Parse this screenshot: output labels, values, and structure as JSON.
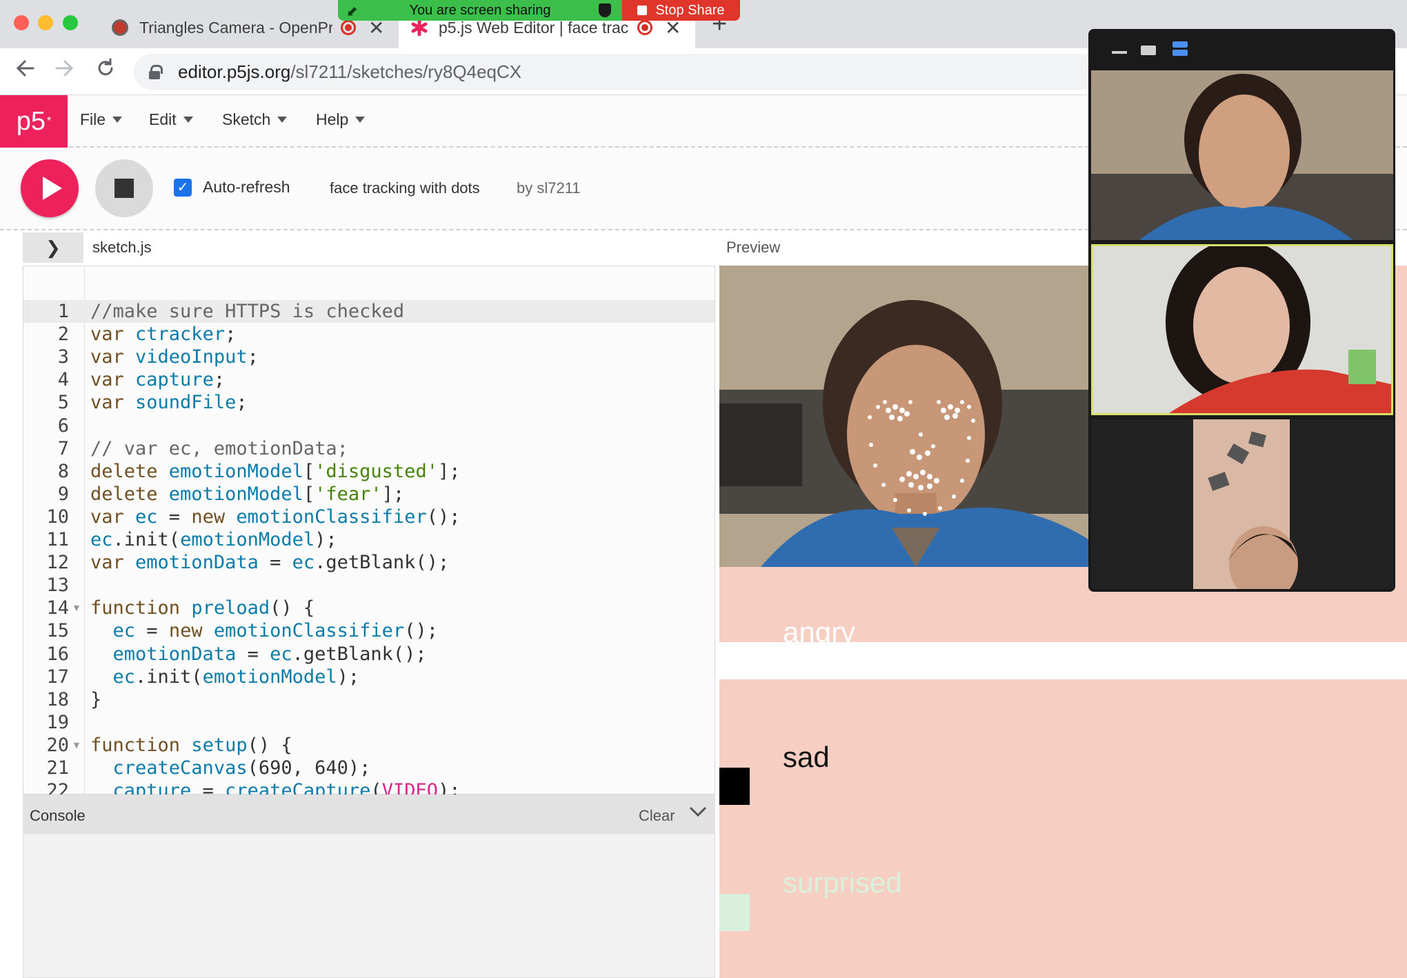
{
  "browser": {
    "tabs": [
      {
        "title": "Triangles Camera - OpenPr",
        "recording": true
      },
      {
        "title": "p5.js Web Editor | face trac",
        "recording": true,
        "active": true
      }
    ],
    "url_domain": "editor.p5js.org",
    "url_path": "/sl7211/sketches/ry8Q4eqCX",
    "icons": {
      "back": "arrow-left-icon",
      "forward": "arrow-right-icon",
      "reload": "reload-icon",
      "new_tab": "plus-icon",
      "close": "close-icon"
    }
  },
  "share_banner": {
    "message": "You are screen sharing",
    "stop_label": "Stop Share"
  },
  "p5": {
    "logo": "p5",
    "logo_mark": "*",
    "menus": [
      {
        "label": "File"
      },
      {
        "label": "Edit"
      },
      {
        "label": "Sketch"
      },
      {
        "label": "Help"
      }
    ],
    "toolbar": {
      "auto_refresh_label": "Auto-refresh",
      "auto_refresh_checked": true,
      "sketch_name": "face tracking with dots",
      "by_user": "by sl7211"
    },
    "file_tab": "sketch.js",
    "preview_label": "Preview",
    "console_label": "Console",
    "clear_label": "Clear",
    "accent": "#ed225d"
  },
  "code_lines": [
    [
      [
        "com",
        "//make sure HTTPS is checked"
      ]
    ],
    [
      [
        "kw",
        "var "
      ],
      [
        "def",
        "ctracker"
      ],
      [
        "p",
        ";"
      ]
    ],
    [
      [
        "kw",
        "var "
      ],
      [
        "def",
        "videoInput"
      ],
      [
        "p",
        ";"
      ]
    ],
    [
      [
        "kw",
        "var "
      ],
      [
        "def",
        "capture"
      ],
      [
        "p",
        ";"
      ]
    ],
    [
      [
        "kw",
        "var "
      ],
      [
        "def",
        "soundFile"
      ],
      [
        "p",
        ";"
      ]
    ],
    [],
    [
      [
        "com",
        "// var ec, emotionData;"
      ]
    ],
    [
      [
        "kw",
        "delete "
      ],
      [
        "var",
        "emotionModel"
      ],
      [
        "p",
        "["
      ],
      [
        "str",
        "'disgusted'"
      ],
      [
        "p",
        "];"
      ]
    ],
    [
      [
        "kw",
        "delete "
      ],
      [
        "var",
        "emotionModel"
      ],
      [
        "p",
        "["
      ],
      [
        "str",
        "'fear'"
      ],
      [
        "p",
        "];"
      ]
    ],
    [
      [
        "kw",
        "var "
      ],
      [
        "def",
        "ec"
      ],
      [
        "p",
        " = "
      ],
      [
        "kw",
        "new "
      ],
      [
        "var",
        "emotionClassifier"
      ],
      [
        "p",
        "();"
      ]
    ],
    [
      [
        "var",
        "ec"
      ],
      [
        "p",
        ".init("
      ],
      [
        "var",
        "emotionModel"
      ],
      [
        "p",
        ");"
      ]
    ],
    [
      [
        "kw",
        "var "
      ],
      [
        "def",
        "emotionData"
      ],
      [
        "p",
        " = "
      ],
      [
        "var",
        "ec"
      ],
      [
        "p",
        ".getBlank();"
      ]
    ],
    [],
    [
      [
        "kw",
        "function "
      ],
      [
        "def",
        "preload"
      ],
      [
        "p",
        "() {"
      ]
    ],
    [
      [
        "p",
        "  "
      ],
      [
        "var",
        "ec"
      ],
      [
        "p",
        " = "
      ],
      [
        "kw",
        "new "
      ],
      [
        "var",
        "emotionClassifier"
      ],
      [
        "p",
        "();"
      ]
    ],
    [
      [
        "p",
        "  "
      ],
      [
        "var",
        "emotionData"
      ],
      [
        "p",
        " = "
      ],
      [
        "var",
        "ec"
      ],
      [
        "p",
        ".getBlank();"
      ]
    ],
    [
      [
        "p",
        "  "
      ],
      [
        "var",
        "ec"
      ],
      [
        "p",
        ".init("
      ],
      [
        "var",
        "emotionModel"
      ],
      [
        "p",
        ");"
      ]
    ],
    [
      [
        "p",
        "}"
      ]
    ],
    [],
    [
      [
        "kw",
        "function "
      ],
      [
        "def",
        "setup"
      ],
      [
        "p",
        "() {"
      ]
    ],
    [
      [
        "p",
        "  "
      ],
      [
        "var",
        "createCanvas"
      ],
      [
        "p",
        "(690, 640);"
      ]
    ],
    [
      [
        "p",
        "  "
      ],
      [
        "var",
        "capture"
      ],
      [
        "p",
        " = "
      ],
      [
        "var",
        "createCapture"
      ],
      [
        "p",
        "("
      ],
      [
        "const",
        "VIDEO"
      ],
      [
        "p",
        ");"
      ]
    ]
  ],
  "fold_markers": [
    14,
    20
  ],
  "preview": {
    "emotions": [
      {
        "label": "angry",
        "color": "#ffffff"
      },
      {
        "label": "sad",
        "color": "#111111"
      },
      {
        "label": "surprised",
        "color": "#d9f1dc"
      }
    ],
    "background": "#f6cfc2"
  },
  "zoom_window": {
    "controls": [
      "minimize-icon",
      "gallery-view-icon",
      "speaker-view-icon"
    ]
  }
}
